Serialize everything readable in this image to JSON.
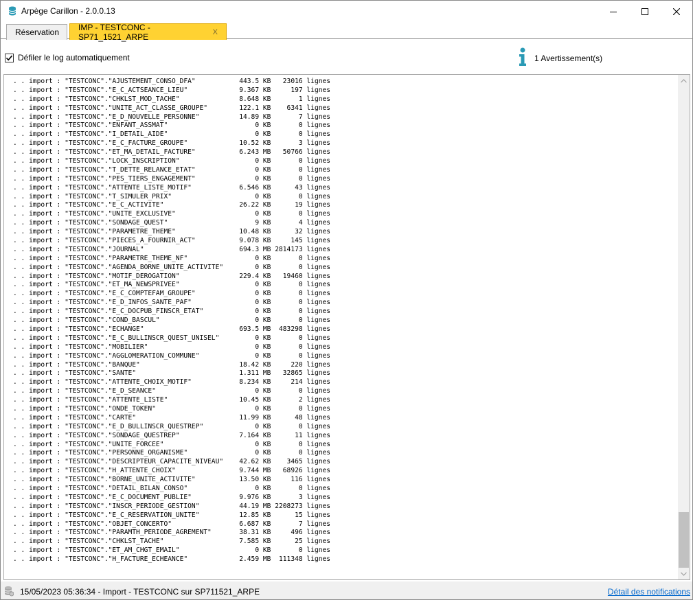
{
  "window": {
    "title": "Arpège Carillon - 2.0.0.13",
    "icon": "database-icon"
  },
  "tabs": [
    {
      "label": "Réservation",
      "active": false
    },
    {
      "label": "IMP - TESTCONC - SP71_1521_ARPE",
      "active": true,
      "close": "X"
    }
  ],
  "options": {
    "autoscroll_label": "Défiler le log automatiquement",
    "autoscroll_checked": true,
    "warnings_label": "1 Avertissement(s)"
  },
  "log": [
    ". . import : \"TESTCONC\".\"AJUSTEMENT_CONSO_DFA\"           443.5 KB   23016 lignes",
    ". . import : \"TESTCONC\".\"E_C_ACTSEANCE_LIEU\"             9.367 KB     197 lignes",
    ". . import : \"TESTCONC\".\"CHKLST_MOD_TACHE\"               8.648 KB       1 lignes",
    ". . import : \"TESTCONC\".\"UNITE_ACT_CLASSE_GROUPE\"        122.1 KB    6341 lignes",
    ". . import : \"TESTCONC\".\"E_D_NOUVELLE_PERSONNE\"          14.89 KB       7 lignes",
    ". . import : \"TESTCONC\".\"ENFANT_ASSMAT\"                      0 KB       0 lignes",
    ". . import : \"TESTCONC\".\"I_DETAIL_AIDE\"                      0 KB       0 lignes",
    ". . import : \"TESTCONC\".\"E_C_FACTURE_GROUPE\"             10.52 KB       3 lignes",
    ". . import : \"TESTCONC\".\"ET_MA_DETAIL_FACTURE\"           6.243 MB   50766 lignes",
    ". . import : \"TESTCONC\".\"LOCK_INSCRIPTION\"                   0 KB       0 lignes",
    ". . import : \"TESTCONC\".\"T_DETTE_RELANCE_ETAT\"               0 KB       0 lignes",
    ". . import : \"TESTCONC\".\"PES_TIERS_ENGAGEMENT\"               0 KB       0 lignes",
    ". . import : \"TESTCONC\".\"ATTENTE_LISTE_MOTIF\"            6.546 KB      43 lignes",
    ". . import : \"TESTCONC\".\"T_SIMULER_PRIX\"                     0 KB       0 lignes",
    ". . import : \"TESTCONC\".\"E_C_ACTIVITE\"                   26.22 KB      19 lignes",
    ". . import : \"TESTCONC\".\"UNITE_EXCLUSIVE\"                    0 KB       0 lignes",
    ". . import : \"TESTCONC\".\"SONDAGE_QUEST\"                      9 KB       4 lignes",
    ". . import : \"TESTCONC\".\"PARAMETRE_THEME\"                10.48 KB      32 lignes",
    ". . import : \"TESTCONC\".\"PIECES_A_FOURNIR_ACT\"           9.078 KB     145 lignes",
    ". . import : \"TESTCONC\".\"JOURNAL\"                        694.3 MB 2814173 lignes",
    ". . import : \"TESTCONC\".\"PARAMETRE_THEME_NF\"                 0 KB       0 lignes",
    ". . import : \"TESTCONC\".\"AGENDA_BORNE_UNITE_ACTIVITE\"        0 KB       0 lignes",
    ". . import : \"TESTCONC\".\"MOTIF_DEROGATION\"               229.4 KB   19460 lignes",
    ". . import : \"TESTCONC\".\"ET_MA_NEWSPRIVEE\"                   0 KB       0 lignes",
    ". . import : \"TESTCONC\".\"E_C_COMPTEFAM_GROUPE\"               0 KB       0 lignes",
    ". . import : \"TESTCONC\".\"E_D_INFOS_SANTE_PAF\"                0 KB       0 lignes",
    ". . import : \"TESTCONC\".\"E_C_DOCPUB_FINSCR_ETAT\"             0 KB       0 lignes",
    ". . import : \"TESTCONC\".\"COND_BASCUL\"                        0 KB       0 lignes",
    ". . import : \"TESTCONC\".\"ECHANGE\"                        693.5 MB  483298 lignes",
    ". . import : \"TESTCONC\".\"E_C_BULLINSCR_QUEST_UNISEL\"         0 KB       0 lignes",
    ". . import : \"TESTCONC\".\"MOBILIER\"                           0 KB       0 lignes",
    ". . import : \"TESTCONC\".\"AGGLOMERATION_COMMUNE\"              0 KB       0 lignes",
    ". . import : \"TESTCONC\".\"BANQUE\"                         18.42 KB     220 lignes",
    ". . import : \"TESTCONC\".\"SANTE\"                          1.311 MB   32865 lignes",
    ". . import : \"TESTCONC\".\"ATTENTE_CHOIX_MOTIF\"            8.234 KB     214 lignes",
    ". . import : \"TESTCONC\".\"E_D_SEANCE\"                         0 KB       0 lignes",
    ". . import : \"TESTCONC\".\"ATTENTE_LISTE\"                  10.45 KB       2 lignes",
    ". . import : \"TESTCONC\".\"ONDE_TOKEN\"                         0 KB       0 lignes",
    ". . import : \"TESTCONC\".\"CARTE\"                          11.99 KB      48 lignes",
    ". . import : \"TESTCONC\".\"E_D_BULLINSCR_QUESTREP\"             0 KB       0 lignes",
    ". . import : \"TESTCONC\".\"SONDAGE_QUESTREP\"               7.164 KB      11 lignes",
    ". . import : \"TESTCONC\".\"UNITE_FORCEE\"                       0 KB       0 lignes",
    ". . import : \"TESTCONC\".\"PERSONNE_ORGANISME\"                 0 KB       0 lignes",
    ". . import : \"TESTCONC\".\"DESCRIPTEUR_CAPACITE_NIVEAU\"    42.62 KB    3465 lignes",
    ". . import : \"TESTCONC\".\"H_ATTENTE_CHOIX\"                9.744 MB   68926 lignes",
    ". . import : \"TESTCONC\".\"BORNE_UNITE_ACTIVITE\"           13.50 KB     116 lignes",
    ". . import : \"TESTCONC\".\"DETAIL_BILAN_CONSO\"                 0 KB       0 lignes",
    ". . import : \"TESTCONC\".\"E_C_DOCUMENT_PUBLIE\"            9.976 KB       3 lignes",
    ". . import : \"TESTCONC\".\"INSCR_PERIODE_GESTION\"          44.19 MB 2208273 lignes",
    ". . import : \"TESTCONC\".\"E_C_RESERVATION_UNITE\"          12.85 KB      15 lignes",
    ". . import : \"TESTCONC\".\"OBJET_CONCERTO\"                 6.687 KB       7 lignes",
    ". . import : \"TESTCONC\".\"PARAMTH_PERIODE_AGREMENT\"       38.31 KB     496 lignes",
    ". . import : \"TESTCONC\".\"CHKLST_TACHE\"                   7.585 KB      25 lignes",
    ". . import : \"TESTCONC\".\"ET_AM_CHGT_EMAIL\"                   0 KB       0 lignes",
    ". . import : \"TESTCONC\".\"H_FACTURE_ECHEANCE\"             2.459 MB  111348 lignes"
  ],
  "status": {
    "text": "15/05/2023 05:36:34 - Import - TESTCONC sur SP711521_ARPE",
    "link": "Détail des notifications"
  },
  "colors": {
    "active_tab": "#ffd232",
    "info_icon": "#2a9ab5",
    "link": "#0066cc"
  }
}
